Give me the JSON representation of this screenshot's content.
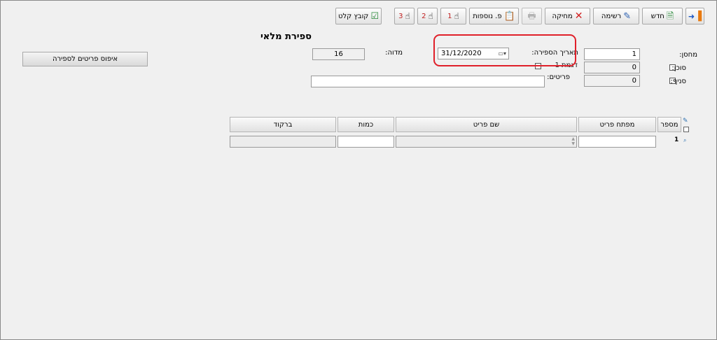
{
  "toolbar": {
    "exit_icon": "exit-door-icon",
    "new_label": "חדש",
    "list_label": "רשימה",
    "delete_label": "מחיקה",
    "print_icon": "printer-icon",
    "extra_label": "פ. נוספות",
    "hand1_label": "1",
    "hand2_label": "2",
    "hand3_label": "3",
    "import_label": "קובץ קלט"
  },
  "form": {
    "title": "ספירת מלאי",
    "warehouse_label": "מחסן:",
    "warehouse_value": "1",
    "agent_label": "סוכן:",
    "agent_value": "0",
    "category_label": "סניף:",
    "category_value": "0",
    "count_date_label": "תאריך הספירה:",
    "count_date_value": "31/12/2020",
    "plan_label": "דגמת 1",
    "items_label": "פריטים:",
    "items_value": "",
    "version_label": "מדוה:",
    "version_value": "16",
    "reset_button_label": "איפוס פריטים לספירה"
  },
  "grid": {
    "columns": [
      "מספר",
      "מפתח פריט",
      "שם פריט",
      "כמות",
      "ברקוד"
    ],
    "rows": [
      {
        "number": "1",
        "item_key": "",
        "item_name": "",
        "quantity": "",
        "barcode": ""
      }
    ]
  },
  "highlight_color": "#e0202a"
}
